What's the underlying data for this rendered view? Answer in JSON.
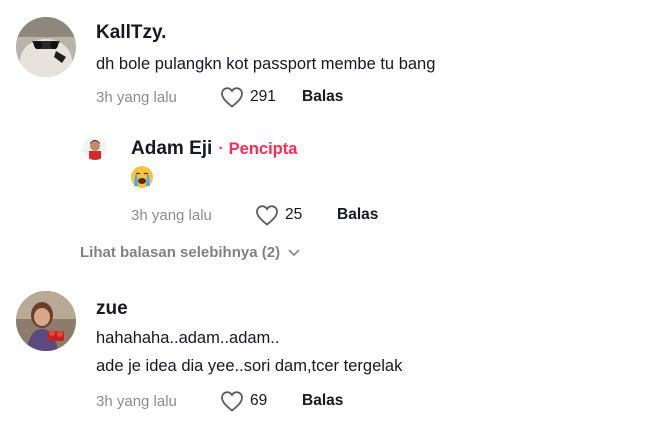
{
  "comments": [
    {
      "author": "KallTzy.",
      "text": "dh bole pulangkn kot passport membe tu bang",
      "time": "3h yang lalu",
      "likes": "291",
      "reply_label": "Balas",
      "replies": [
        {
          "author": "Adam Eji",
          "creator_separator": "·",
          "creator_badge": "Pencipta",
          "emoji": "loudly-crying-face-emoji",
          "time": "3h yang lalu",
          "likes": "25",
          "reply_label": "Balas"
        }
      ],
      "more_replies_label": "Lihat balasan selebihnya (2)"
    },
    {
      "author": "zue",
      "text_lines": [
        "hahahaha..adam..adam..",
        "ade je idea dia yee..sori dam,tcer tergelak"
      ],
      "time": "3h yang lalu",
      "likes": "69",
      "reply_label": "Balas"
    }
  ],
  "colors": {
    "creator": "#fe2c55",
    "muted": "#8a8b91",
    "text": "#161823"
  }
}
